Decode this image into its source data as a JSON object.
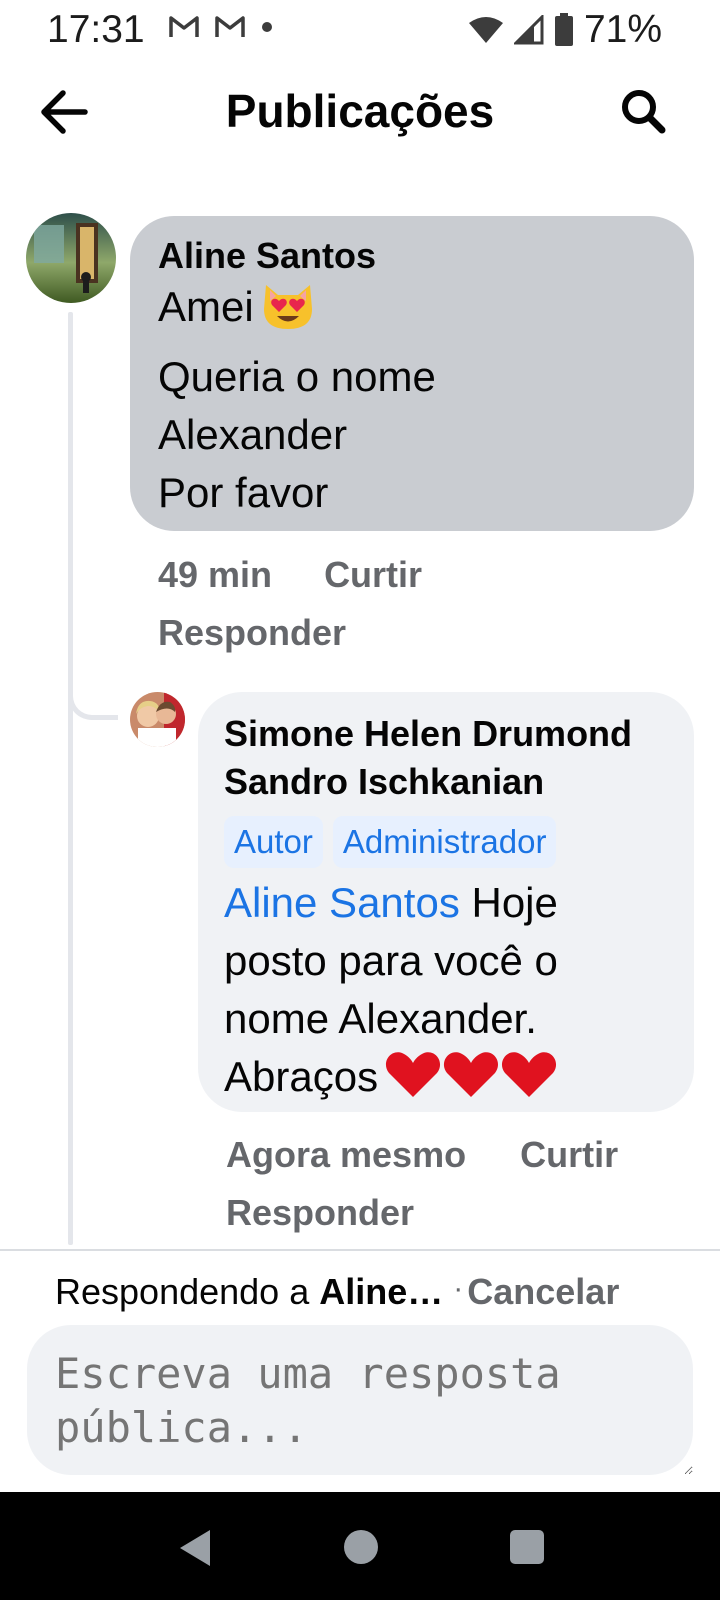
{
  "status_bar": {
    "time": "17:31",
    "battery_percent": "71%",
    "notification_icons": [
      "gmail-icon",
      "gmail-icon",
      "dot-icon"
    ],
    "right_icons": [
      "wifi-icon",
      "signal-icon",
      "battery-icon"
    ]
  },
  "header": {
    "title": "Publicações",
    "back_icon": "arrow-left-icon",
    "search_icon": "search-icon"
  },
  "comment": {
    "author": "Aline Santos",
    "line1": "Amei",
    "emoji": "heart-eyes-cat-emoji",
    "line2": "Queria o nome\nAlexander\nPor favor",
    "time": "49 min",
    "like_label": "Curtir",
    "reply_label": "Responder",
    "bubble_color": "#c9ccd1"
  },
  "reply": {
    "author": "Simone Helen Drumond Sandro Ischkanian",
    "badges": [
      "Autor",
      "Administrador"
    ],
    "mention": "Aline Santos",
    "text": " Hoje posto para você o nome Alexander. Abraços",
    "emoji": "red-heart-emoji",
    "time": "Agora mesmo",
    "like_label": "Curtir",
    "reply_label": "Responder"
  },
  "composer": {
    "replying_prefix": "Respondendo a",
    "replying_to": "Aline…",
    "separator": "·",
    "cancel_label": "Cancelar",
    "placeholder": "Escreva uma resposta pública..."
  },
  "colors": {
    "accent": "#1b74e4",
    "muted_text": "#65676b",
    "reply_bubble": "#f0f2f5"
  }
}
